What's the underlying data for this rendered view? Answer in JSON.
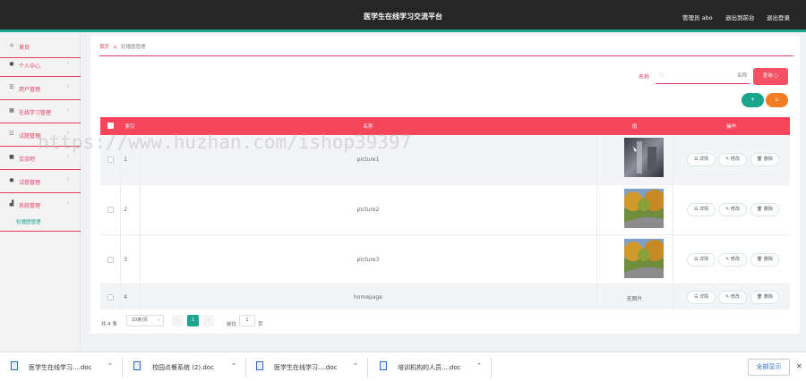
{
  "header": {
    "title": "医学生在线学习交流平台",
    "user": "管理员 abo",
    "to_front": "退出到前台",
    "logout": "退出登录"
  },
  "sidebar": {
    "items": [
      {
        "label": "首页",
        "icon": "home-icon"
      },
      {
        "label": "个人中心",
        "icon": "user-icon"
      },
      {
        "label": "用户管理",
        "icon": "list-icon"
      },
      {
        "label": "在线学习管理",
        "icon": "grid-icon"
      },
      {
        "label": "试题管理",
        "icon": "list-icon"
      },
      {
        "label": "交流吧",
        "icon": "lock-icon"
      },
      {
        "label": "试卷管理",
        "icon": "user-icon"
      },
      {
        "label": "系统管理",
        "icon": "chart-icon"
      }
    ],
    "subitem": "轮播图管理"
  },
  "breadcrumb": {
    "home": "首页",
    "current": "轮播图管理"
  },
  "search": {
    "label": "名称",
    "placeholder": "名称",
    "button": "查询"
  },
  "actions": {
    "add": "+",
    "delete": "☰"
  },
  "table": {
    "headers": [
      "索引",
      "名称",
      "值",
      "操作"
    ],
    "rows": [
      {
        "index": "1",
        "name": "picture1",
        "value": "",
        "image": "dark"
      },
      {
        "index": "2",
        "name": "picture2",
        "value": "",
        "image": "park"
      },
      {
        "index": "3",
        "name": "picture3",
        "value": "",
        "image": "park"
      },
      {
        "index": "4",
        "name": "homepage",
        "value": "无图片",
        "image": ""
      }
    ],
    "row_actions": {
      "detail": "详情",
      "edit": "修改",
      "delete": "删除"
    }
  },
  "pagination": {
    "total": "共 4 条",
    "page_size": "10条/页",
    "current": "1",
    "goto_label": "前往",
    "goto_value": "1",
    "page_unit": "页"
  },
  "watermark": "https://www.huzhan.com/ishop39397",
  "downloads": [
    {
      "name": "医学生在线学习....doc"
    },
    {
      "name": "校园点餐系统 (2).doc"
    },
    {
      "name": "医学生在线学习....doc"
    },
    {
      "name": "培训机构的人员....doc"
    }
  ],
  "download_bar": {
    "show_all": "全部显示",
    "close": "✕"
  },
  "colors": {
    "accent": "#f5455b",
    "teal": "#1aa58f",
    "header": "#262626"
  }
}
